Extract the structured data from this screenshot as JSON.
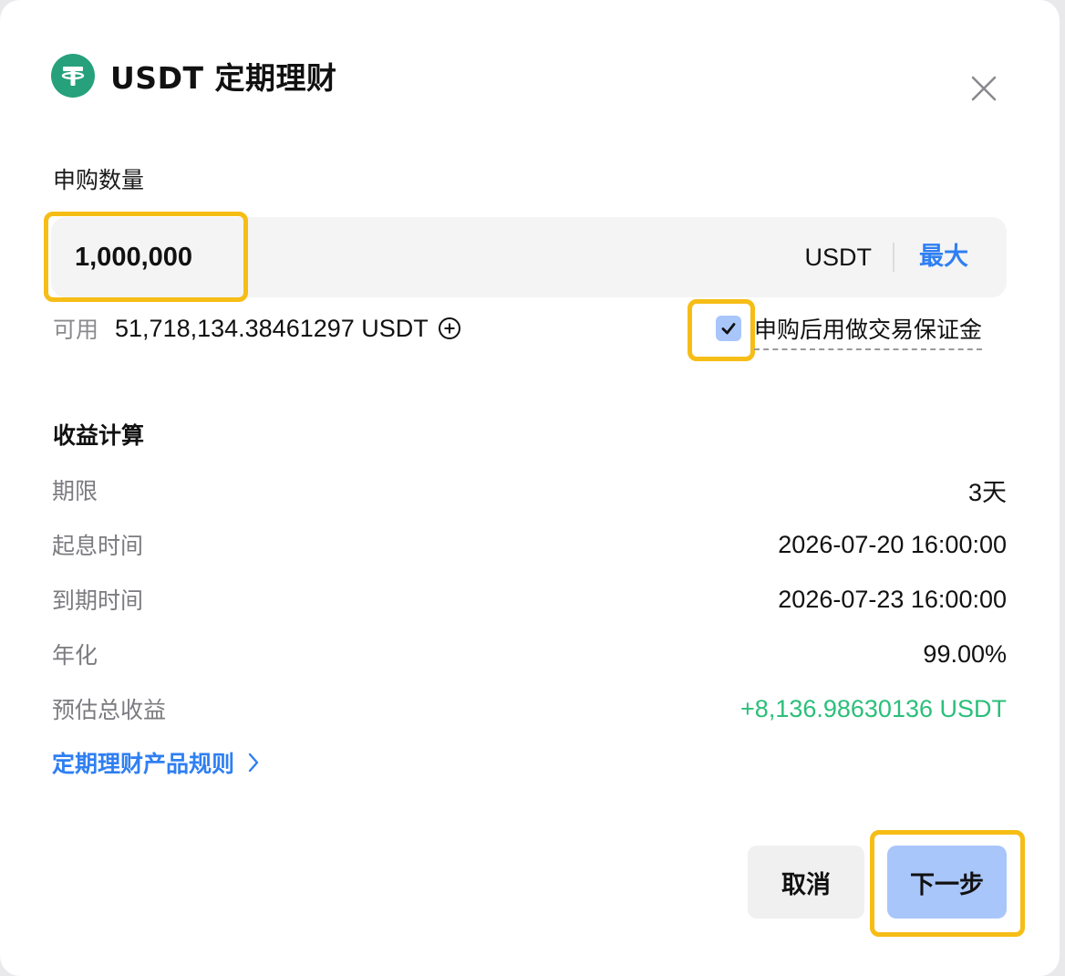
{
  "header": {
    "title": "USDT 定期理财",
    "coin_icon": "tether-icon",
    "coin_color": "#26a17b"
  },
  "subscribe": {
    "label": "申购数量",
    "amount_value": "1,000,000",
    "unit": "USDT",
    "max_label": "最大",
    "available_label": "可用",
    "available_value": "51,718,134.38461297 USDT",
    "margin_checked": true,
    "margin_label": "申购后用做交易保证金"
  },
  "calc": {
    "title": "收益计算",
    "rows": [
      {
        "label": "期限",
        "value": "3天"
      },
      {
        "label": "起息时间",
        "value": "2026-07-20 16:00:00"
      },
      {
        "label": "到期时间",
        "value": "2026-07-23 16:00:00"
      },
      {
        "label": "年化",
        "value": "99.00%"
      },
      {
        "label": "预估总收益",
        "value": "+8,136.98630136 USDT"
      }
    ]
  },
  "rules_link": "定期理财产品规则",
  "buttons": {
    "cancel": "取消",
    "next": "下一步"
  },
  "colors": {
    "accent": "#2f7ff2",
    "positive": "#2bbf7a",
    "highlight": "#f6bd16",
    "primary_button": "#a9c6fb"
  }
}
